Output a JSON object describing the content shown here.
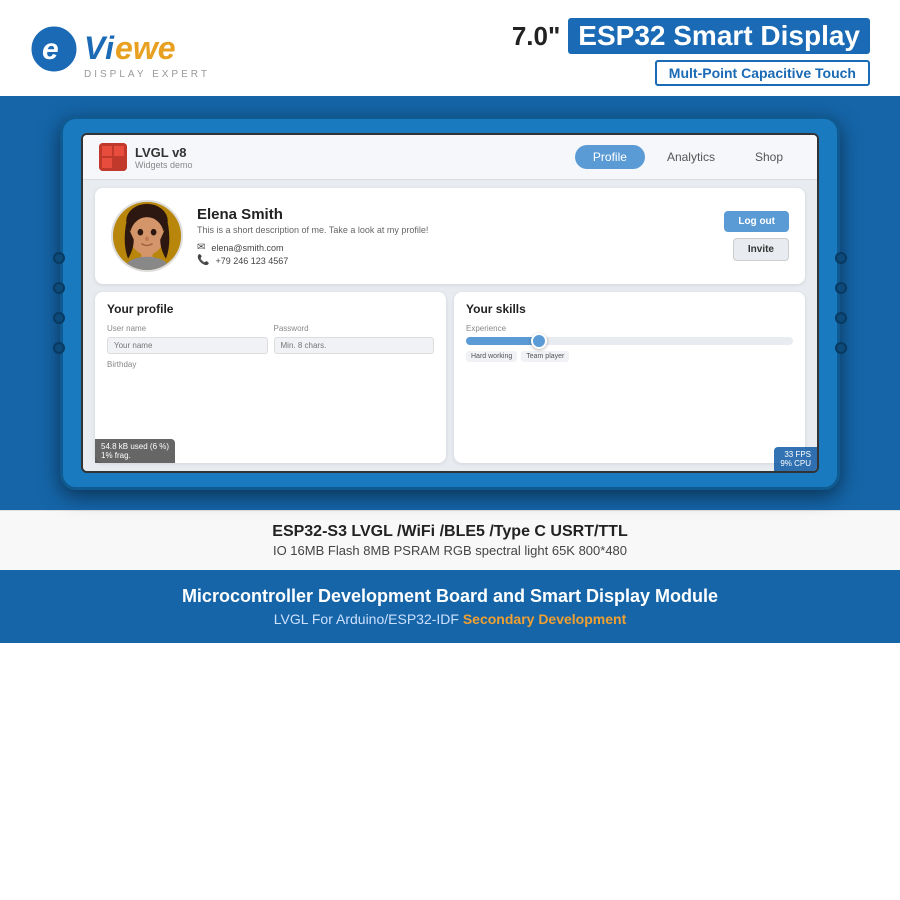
{
  "header": {
    "logo_text": "viewe",
    "display_expert": "DISPLAY EXPERT",
    "main_title_part1": "7.0\"",
    "main_title_part2": "ESP32 Smart Display",
    "subtitle": "Mult-Point Capacitive Touch"
  },
  "screen": {
    "app_name": "LVGL v8",
    "app_subtitle": "Widgets demo",
    "tabs": [
      {
        "label": "Profile",
        "active": true
      },
      {
        "label": "Analytics",
        "active": false
      },
      {
        "label": "Shop",
        "active": false
      }
    ],
    "profile": {
      "name": "Elena Smith",
      "description": "This is a short description of me. Take a look at my profile!",
      "email": "elena@smith.com",
      "phone": "+79 246 123 4567",
      "btn_logout": "Log out",
      "btn_invite": "Invite"
    },
    "your_profile": {
      "title": "Your profile",
      "username_label": "User name",
      "username_placeholder": "Your name",
      "password_label": "Password",
      "password_placeholder": "Min. 8 chars.",
      "birthday_label": "Birthday"
    },
    "your_skills": {
      "title": "Your skills",
      "experience_label": "Experience",
      "tags": [
        "Hard working",
        "Team player"
      ]
    },
    "status_left": "54.8 kB used (6 %)\n1% frag.",
    "status_right": "33 FPS\n9% CPU"
  },
  "specs": {
    "line1": "ESP32-S3 LVGL  /WiFi /BLE5 /Type C   USRT/TTL",
    "line2": "IO 16MB  Flash  8MB  PSRAM   RGB spectral light  65K  800*480"
  },
  "footer": {
    "line1": "Microcontroller Development Board and Smart Display Module",
    "line2_prefix": "LVGL For Arduino/ESP32-IDF",
    "line2_accent": "Secondary Development"
  }
}
